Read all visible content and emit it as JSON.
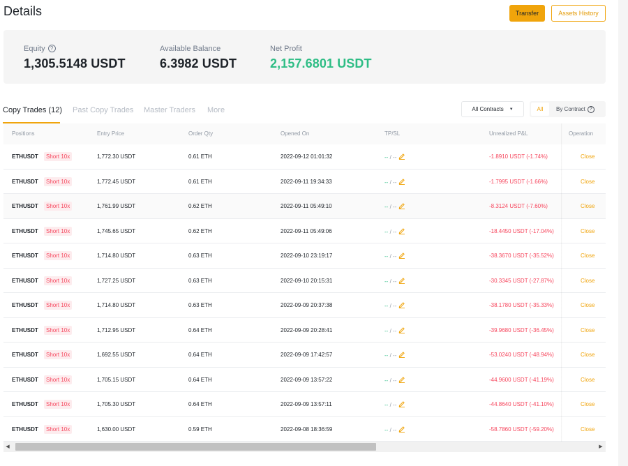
{
  "header": {
    "title": "Details",
    "transfer_label": "Transfer",
    "assets_history_label": "Assets History"
  },
  "summary": {
    "equity_label": "Equity",
    "equity_value": "1,305.5148 USDT",
    "available_label": "Available Balance",
    "available_value": "6.3982 USDT",
    "net_profit_label": "Net Profit",
    "net_profit_value": "2,157.6801 USDT"
  },
  "tabs": {
    "copy_trades": "Copy Trades (12)",
    "past_copy_trades": "Past Copy Trades",
    "master_traders": "Master Traders",
    "more": "More"
  },
  "filters": {
    "contracts_selected": "All Contracts",
    "seg_all": "All",
    "seg_by_contract": "By Contract"
  },
  "table": {
    "columns": [
      "Positions",
      "Entry Price",
      "Order Qty",
      "Opened On",
      "TP/SL",
      "Unrealized P&L",
      "Operation"
    ],
    "tpsl_tp": "--",
    "tpsl_sep": "/",
    "tpsl_sl": "--",
    "close_label": "Close",
    "rows": [
      {
        "symbol": "ETHUSDT",
        "side": "Short 10x",
        "entry_price": "1,772.30 USDT",
        "qty": "0.61 ETH",
        "opened": "2022-09-12 01:01:32",
        "pnl": "-1.8910 USDT (-1.74%)"
      },
      {
        "symbol": "ETHUSDT",
        "side": "Short 10x",
        "entry_price": "1,772.45 USDT",
        "qty": "0.61 ETH",
        "opened": "2022-09-11 19:34:33",
        "pnl": "-1.7995 USDT (-1.66%)"
      },
      {
        "symbol": "ETHUSDT",
        "side": "Short 10x",
        "entry_price": "1,761.99 USDT",
        "qty": "0.62 ETH",
        "opened": "2022-09-11 05:49:10",
        "pnl": "-8.3124 USDT (-7.60%)"
      },
      {
        "symbol": "ETHUSDT",
        "side": "Short 10x",
        "entry_price": "1,745.65 USDT",
        "qty": "0.62 ETH",
        "opened": "2022-09-11 05:49:06",
        "pnl": "-18.4450 USDT (-17.04%)"
      },
      {
        "symbol": "ETHUSDT",
        "side": "Short 10x",
        "entry_price": "1,714.80 USDT",
        "qty": "0.63 ETH",
        "opened": "2022-09-10 23:19:17",
        "pnl": "-38.3670 USDT (-35.52%)"
      },
      {
        "symbol": "ETHUSDT",
        "side": "Short 10x",
        "entry_price": "1,727.25 USDT",
        "qty": "0.63 ETH",
        "opened": "2022-09-10 20:15:31",
        "pnl": "-30.3345 USDT (-27.87%)"
      },
      {
        "symbol": "ETHUSDT",
        "side": "Short 10x",
        "entry_price": "1,714.80 USDT",
        "qty": "0.63 ETH",
        "opened": "2022-09-09 20:37:38",
        "pnl": "-38.1780 USDT (-35.33%)"
      },
      {
        "symbol": "ETHUSDT",
        "side": "Short 10x",
        "entry_price": "1,712.95 USDT",
        "qty": "0.64 ETH",
        "opened": "2022-09-09 20:28:41",
        "pnl": "-39.9680 USDT (-36.45%)"
      },
      {
        "symbol": "ETHUSDT",
        "side": "Short 10x",
        "entry_price": "1,692.55 USDT",
        "qty": "0.64 ETH",
        "opened": "2022-09-09 17:42:57",
        "pnl": "-53.0240 USDT (-48.94%)"
      },
      {
        "symbol": "ETHUSDT",
        "side": "Short 10x",
        "entry_price": "1,705.15 USDT",
        "qty": "0.64 ETH",
        "opened": "2022-09-09 13:57:22",
        "pnl": "-44.9600 USDT (-41.19%)"
      },
      {
        "symbol": "ETHUSDT",
        "side": "Short 10x",
        "entry_price": "1,705.30 USDT",
        "qty": "0.64 ETH",
        "opened": "2022-09-09 13:57:11",
        "pnl": "-44.8640 USDT (-41.10%)"
      },
      {
        "symbol": "ETHUSDT",
        "side": "Short 10x",
        "entry_price": "1,630.00 USDT",
        "qty": "0.59 ETH",
        "opened": "2022-09-08 18:36:59",
        "pnl": "-58.7860 USDT (-59.20%)"
      }
    ]
  },
  "colors": {
    "accent": "#f0a40b",
    "profit": "#2ebd85",
    "loss": "#f6465d"
  },
  "icons": {
    "help": "question-circle-icon",
    "edit": "pencil-icon",
    "dropdown": "chevron-down-icon",
    "scroll_left": "scroll-left-arrow-icon",
    "scroll_right": "scroll-right-arrow-icon"
  }
}
